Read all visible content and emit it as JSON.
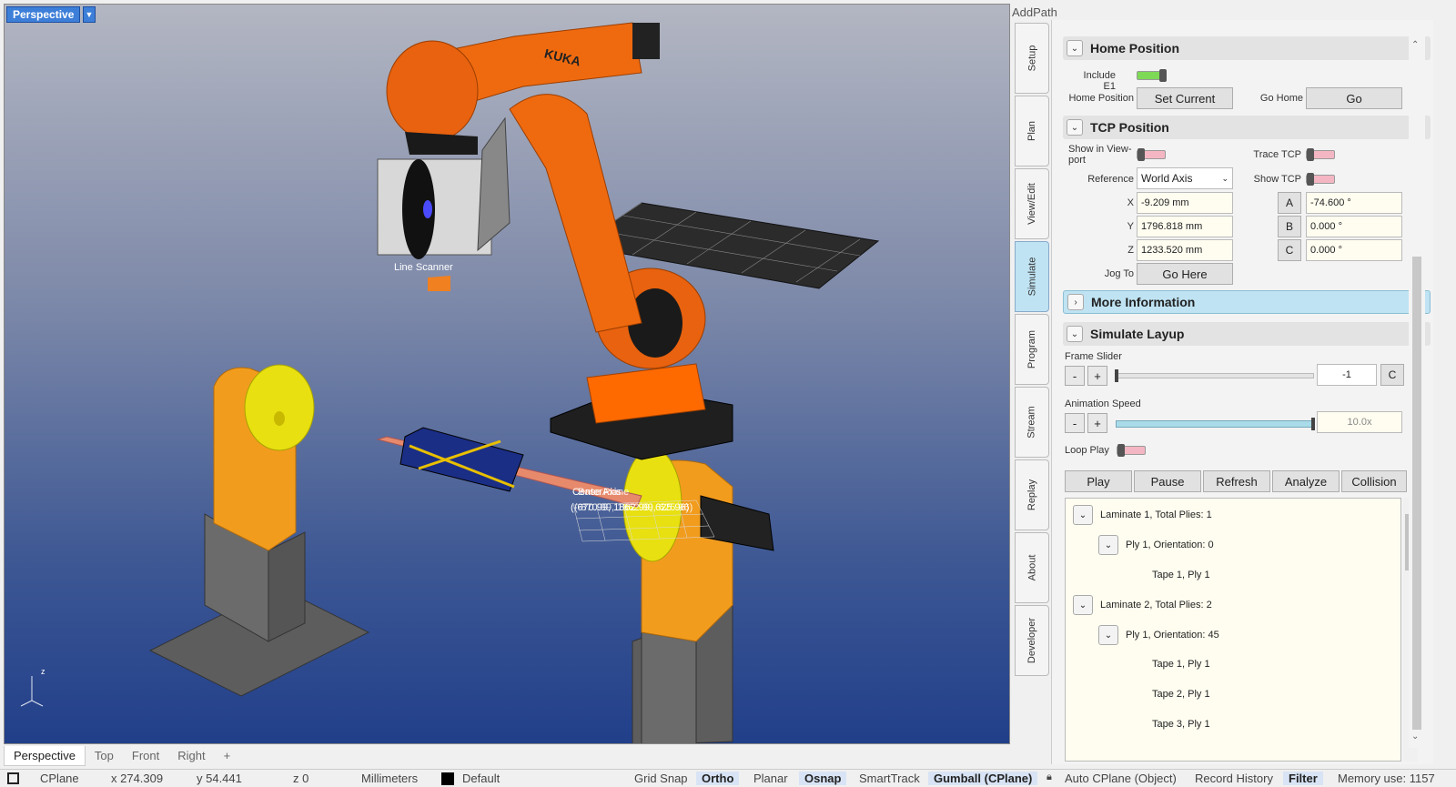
{
  "viewport": {
    "title": "Perspective",
    "labels": {
      "line_scanner": "Line Scanner",
      "center_axis": "CenterAxis",
      "base_plane": "Base Plane",
      "coords_1": "(-670.99, 1862.99, 625.96)",
      "coords_2": "(-870.99, 1862.99, 625.96)",
      "robot_brand": "KUKA",
      "axis_z": "z"
    },
    "tabs": [
      "Perspective",
      "Top",
      "Front",
      "Right"
    ],
    "tab_add": "+"
  },
  "panel": {
    "title": "AddPath",
    "side_tabs": [
      "Setup",
      "Plan",
      "View/Edit",
      "Simulate",
      "Program",
      "Stream",
      "Replay",
      "About",
      "Developer"
    ],
    "home": {
      "title": "Home Position",
      "include_e1": "Include E1",
      "home_position": "Home Position",
      "set_current": "Set Current",
      "go_home": "Go Home",
      "go": "Go"
    },
    "tcp": {
      "title": "TCP Position",
      "show_in_viewport": "Show in View-port",
      "trace_tcp": "Trace TCP",
      "reference": "Reference",
      "reference_value": "World Axis",
      "show_tcp": "Show TCP",
      "x_label": "X",
      "x_value": "-9.209 mm",
      "y_label": "Y",
      "y_value": "1796.818 mm",
      "z_label": "Z",
      "z_value": "1233.520 mm",
      "a_label": "A",
      "a_value": "-74.600 °",
      "b_label": "B",
      "b_value": "0.000 °",
      "c_label": "C",
      "c_value": "0.000 °",
      "jog_to": "Jog To",
      "go_here": "Go Here"
    },
    "more_info": {
      "title": "More Information"
    },
    "simulate": {
      "title": "Simulate Layup",
      "frame_slider": "Frame Slider",
      "minus": "-",
      "plus": "+",
      "frame_value": "-1",
      "c_btn": "C",
      "animation_speed": "Animation Speed",
      "speed_value": "10.0x",
      "loop_play": "Loop Play",
      "buttons": [
        "Play",
        "Pause",
        "Refresh",
        "Analyze",
        "Collision"
      ]
    },
    "tree": [
      {
        "label": "Laminate 1, Total Plies: 1",
        "level": 0
      },
      {
        "label": "Ply 1, Orientation: 0",
        "level": 1
      },
      {
        "label": "Tape 1, Ply 1",
        "level": 2
      },
      {
        "label": "Laminate 2, Total Plies: 2",
        "level": 0
      },
      {
        "label": "Ply 1, Orientation: 45",
        "level": 1
      },
      {
        "label": "Tape 1, Ply 1",
        "level": 2
      },
      {
        "label": "Tape 2, Ply 1",
        "level": 2
      },
      {
        "label": "Tape 3, Ply 1",
        "level": 2
      }
    ]
  },
  "status": {
    "cplane": "CPlane",
    "x": "x 274.309",
    "y": "y 54.441",
    "z": "z 0",
    "units": "Millimeters",
    "layer": "Default",
    "grid_snap": "Grid Snap",
    "ortho": "Ortho",
    "planar": "Planar",
    "osnap": "Osnap",
    "smarttrack": "SmartTrack",
    "gumball": "Gumball (CPlane)",
    "auto_cplane": "Auto CPlane (Object)",
    "record_history": "Record History",
    "filter": "Filter",
    "memory": "Memory use: 1157"
  },
  "colors": {
    "accent": "#3d7fd8",
    "robot_orange": "#e8620f",
    "positioner_yellow": "#e8e010",
    "toggle_on": "#7ed957",
    "toggle_off": "#f4b6c2"
  }
}
